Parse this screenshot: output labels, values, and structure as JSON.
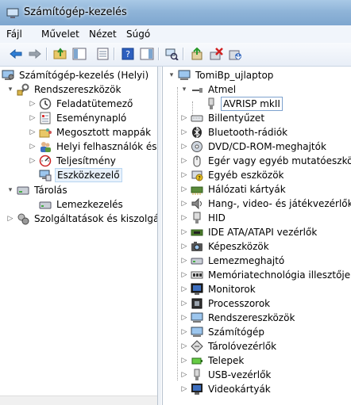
{
  "window": {
    "title": "Számítógép-kezelés",
    "background_text": ""
  },
  "menu": [
    "Fájl",
    "Művelet",
    "Nézet",
    "Súgó"
  ],
  "toolbar": {
    "buttons": [
      "back-icon",
      "forward-icon",
      "up-folder-icon",
      "show-tree-icon",
      "properties-icon",
      "help-icon",
      "action-pane-icon",
      "scan-hardware-icon",
      "update-driver-icon",
      "uninstall-icon",
      "disable-icon"
    ]
  },
  "left_tree": [
    {
      "label": "Számítógép-kezelés (Helyi)",
      "icon": "computer-management-icon",
      "level": 0,
      "expander": ""
    },
    {
      "label": "Rendszereszközök",
      "icon": "system-tools-icon",
      "level": 1,
      "expander": "▾"
    },
    {
      "label": "Feladatütemező",
      "icon": "task-scheduler-icon",
      "level": 2,
      "expander": "▷"
    },
    {
      "label": "Eseménynapló",
      "icon": "event-viewer-icon",
      "level": 2,
      "expander": "▷"
    },
    {
      "label": "Megosztott mappák",
      "icon": "shared-folders-icon",
      "level": 2,
      "expander": "▷"
    },
    {
      "label": "Helyi felhasználók és cs",
      "icon": "local-users-icon",
      "level": 2,
      "expander": "▷"
    },
    {
      "label": "Teljesítmény",
      "icon": "performance-icon",
      "level": 2,
      "expander": "▷"
    },
    {
      "label": "Eszközkezelő",
      "icon": "device-manager-icon",
      "level": 2,
      "expander": "",
      "selected": true
    },
    {
      "label": "Tárolás",
      "icon": "storage-icon",
      "level": 1,
      "expander": "▾"
    },
    {
      "label": "Lemezkezelés",
      "icon": "disk-management-icon",
      "level": 2,
      "expander": ""
    },
    {
      "label": "Szolgáltatások és kiszolgálá",
      "icon": "services-icon",
      "level": 1,
      "expander": "▷"
    }
  ],
  "right_tree": [
    {
      "label": "TomiBp_ujlaptop",
      "icon": "computer-icon",
      "level": 0,
      "expander": "▾"
    },
    {
      "label": "Atmel",
      "icon": "usb-icon",
      "level": 1,
      "expander": "▾"
    },
    {
      "label": "AVRISP mkII",
      "icon": "usb-device-icon",
      "level": 2,
      "expander": "",
      "selected": true
    },
    {
      "label": "Billentyűzet",
      "icon": "keyboard-icon",
      "level": 1,
      "expander": "▷"
    },
    {
      "label": "Bluetooth-rádiók",
      "icon": "bluetooth-icon",
      "level": 1,
      "expander": "▷"
    },
    {
      "label": "DVD/CD-ROM-meghajtók",
      "icon": "dvd-drive-icon",
      "level": 1,
      "expander": "▷"
    },
    {
      "label": "Egér vagy egyéb mutatóeszköz",
      "icon": "mouse-icon",
      "level": 1,
      "expander": "▷"
    },
    {
      "label": "Egyéb eszközök",
      "icon": "other-devices-icon",
      "level": 1,
      "expander": "▷"
    },
    {
      "label": "Hálózati kártyák",
      "icon": "network-adapter-icon",
      "level": 1,
      "expander": "▷"
    },
    {
      "label": "Hang-, video- és játékvezérlők",
      "icon": "sound-icon",
      "level": 1,
      "expander": "▷"
    },
    {
      "label": "HID",
      "icon": "hid-icon",
      "level": 1,
      "expander": "▷"
    },
    {
      "label": "IDE ATA/ATAPI vezérlők",
      "icon": "ide-controller-icon",
      "level": 1,
      "expander": "▷"
    },
    {
      "label": "Képeszközök",
      "icon": "imaging-icon",
      "level": 1,
      "expander": "▷"
    },
    {
      "label": "Lemezmeghajtó",
      "icon": "disk-drive-icon",
      "level": 1,
      "expander": "▷"
    },
    {
      "label": "Memóriatechnológia illesztője",
      "icon": "memory-tech-icon",
      "level": 1,
      "expander": "▷"
    },
    {
      "label": "Monitorok",
      "icon": "monitor-icon",
      "level": 1,
      "expander": "▷"
    },
    {
      "label": "Processzorok",
      "icon": "processor-icon",
      "level": 1,
      "expander": "▷"
    },
    {
      "label": "Rendszereszközök",
      "icon": "system-devices-icon",
      "level": 1,
      "expander": "▷"
    },
    {
      "label": "Számítógép",
      "icon": "computer-icon",
      "level": 1,
      "expander": "▷"
    },
    {
      "label": "Tárolóvezérlők",
      "icon": "storage-controller-icon",
      "level": 1,
      "expander": "▷"
    },
    {
      "label": "Telepek",
      "icon": "battery-icon",
      "level": 1,
      "expander": "▷"
    },
    {
      "label": "USB-vezérlők",
      "icon": "usb-controller-icon",
      "level": 1,
      "expander": "▷"
    },
    {
      "label": "Videokártyák",
      "icon": "display-adapter-icon",
      "level": 1,
      "expander": "▷"
    }
  ],
  "colors": {
    "selection": "#e8f1fb",
    "selection_border": "#b8d6f1",
    "titlebar": "#8fb4d8"
  }
}
